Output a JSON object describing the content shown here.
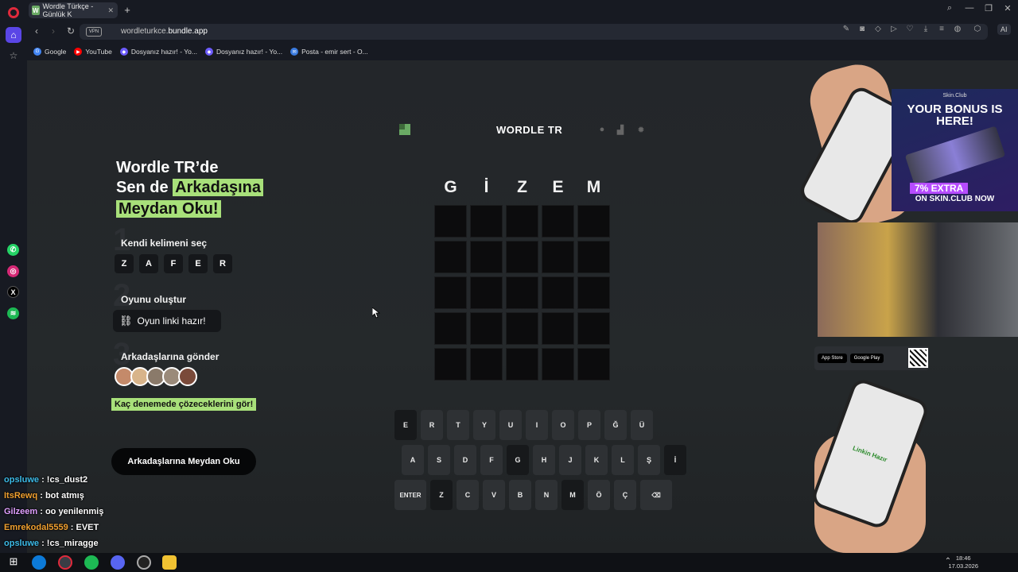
{
  "browser": {
    "tab_title": "Wordle Türkçe - Günlük K",
    "tab_favicon": "W",
    "url_prefix": "wordleturkce.",
    "url_domain": "bundle.app",
    "vpn_label": "VPN",
    "ai_label": "AI"
  },
  "bookmarks": [
    {
      "label": "Google",
      "icon": "google-icon",
      "color": "#4285f4"
    },
    {
      "label": "YouTube",
      "icon": "youtube-icon",
      "color": "#ff0000"
    },
    {
      "label": "Dosyanız hazır! - Yo...",
      "icon": "doc-icon",
      "color": "#6d5cff"
    },
    {
      "label": "Dosyanız hazır! - Yo...",
      "icon": "doc-icon",
      "color": "#6d5cff"
    },
    {
      "label": "Posta - emir sert - O...",
      "icon": "mail-icon",
      "color": "#3a7be0"
    }
  ],
  "hero": {
    "line1": "Wordle TR’de",
    "line2_plain": "Sen de ",
    "line2_highlight": "Arkadaşına",
    "line3_highlight": "Meydan Oku!"
  },
  "steps": [
    {
      "number": "1",
      "title": "Kendi kelimeni seç"
    },
    {
      "number": "2",
      "title": "Oyunu oluştur"
    },
    {
      "number": "3",
      "title": "Arkadaşlarına gönder"
    }
  ],
  "step1_letters": [
    "Z",
    "A",
    "F",
    "E",
    "R"
  ],
  "step2_chip": "Oyun linki hazır!",
  "cta_text": "Kaç denemede çözeceklerini gör!",
  "challenge_button": "Arkadaşlarına Meydan Oku",
  "game": {
    "title": "WORDLE TR",
    "guess_letters": [
      "G",
      "İ",
      "Z",
      "E",
      "M"
    ],
    "rows": 5,
    "cols": 5
  },
  "keyboard": {
    "row1": [
      "E",
      "R",
      "T",
      "Y",
      "U",
      "I",
      "O",
      "P",
      "Ğ",
      "Ü"
    ],
    "row2": [
      "A",
      "S",
      "D",
      "F",
      "G",
      "H",
      "J",
      "K",
      "L",
      "Ş",
      "İ"
    ],
    "row3": [
      "ENTER",
      "Z",
      "C",
      "V",
      "B",
      "N",
      "M",
      "Ö",
      "Ç",
      "⌫"
    ],
    "dark_keys": [
      "E",
      "G",
      "İ",
      "Z",
      "M"
    ]
  },
  "ads": {
    "brand": "Skin.Club",
    "headline": "YOUR BONUS IS HERE!",
    "extra": "7% EXTRA",
    "footer": "ON SKIN.CLUB NOW",
    "app_store": "App Store",
    "google_play": "Google Play",
    "phone_text": "Linkin Hazır"
  },
  "chat": [
    {
      "user": "opsluwe",
      "color": "#3dbbe8",
      "msg": " : !cs_dust2"
    },
    {
      "user": "ItsRewq",
      "color": "#f0a030",
      "msg": " : bot atmış"
    },
    {
      "user": "Gilzeem",
      "color": "#e0a0ff",
      "msg": " : oo yenilenmiş"
    },
    {
      "user": "Emrekodal5559",
      "color": "#f0a030",
      "msg": " : EVET"
    },
    {
      "user": "opsluwe",
      "color": "#3dbbe8",
      "msg": " : !cs_miragge"
    }
  ],
  "taskbar": {
    "time": "18:46",
    "date": "17.03.2026"
  }
}
